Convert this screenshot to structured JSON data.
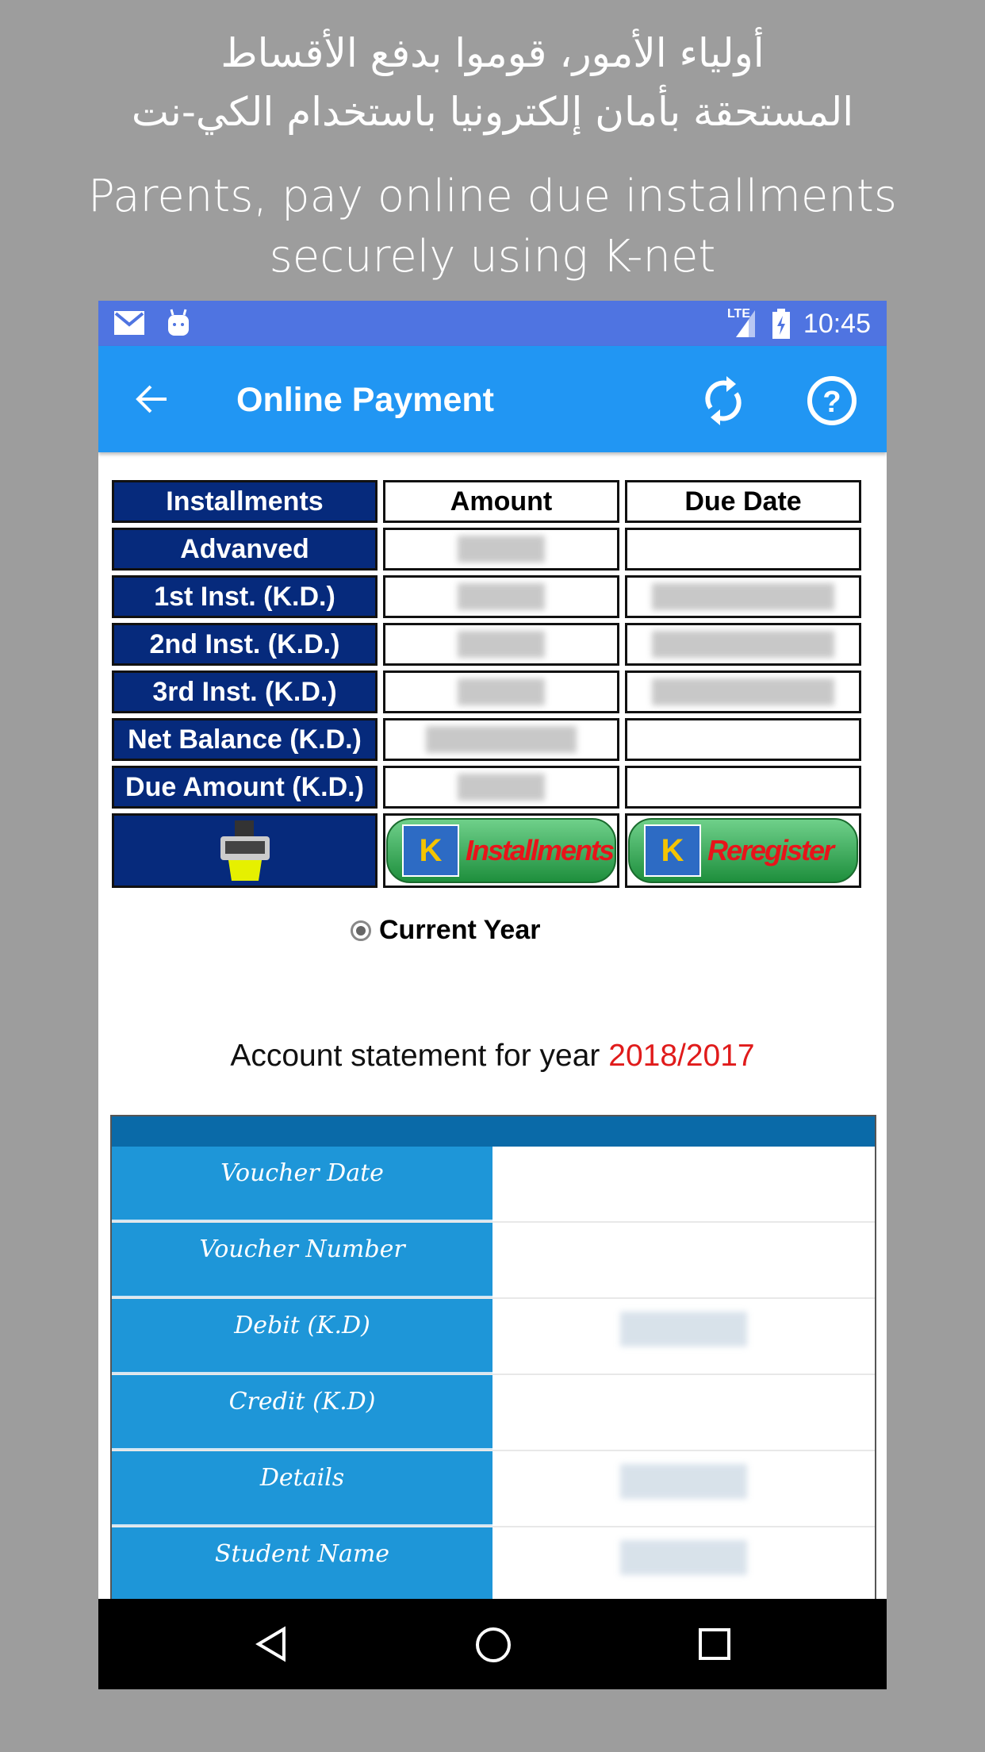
{
  "promo": {
    "arabic_line1": "أولياء الأمور، قوموا بدفع الأقساط",
    "arabic_line2": "المستحقة بأمان إلكترونيا باستخدام الكي-نت",
    "english_line1": "Parents, pay online due installments",
    "english_line2": "securely using K-net"
  },
  "status_bar": {
    "time": "10:45",
    "network": "LTE",
    "icons": [
      "mail-icon",
      "android-icon",
      "signal-icon",
      "battery-charging-icon"
    ]
  },
  "app_bar": {
    "title": "Online Payment",
    "icons": [
      "back-arrow-icon",
      "refresh-icon",
      "help-icon"
    ]
  },
  "installments_table": {
    "headers": [
      "Installments",
      "Amount",
      "Due Date"
    ],
    "rows": [
      {
        "label": "Advanved",
        "amount_blurred": true,
        "due_blurred": false
      },
      {
        "label": "1st Inst. (K.D.)",
        "amount_blurred": true,
        "due_blurred": true
      },
      {
        "label": "2nd Inst. (K.D.)",
        "amount_blurred": true,
        "due_blurred": true
      },
      {
        "label": "3rd Inst. (K.D.)",
        "amount_blurred": true,
        "due_blurred": true
      },
      {
        "label": "Net Balance (K.D.)",
        "amount_blurred": true,
        "due_blurred": false
      },
      {
        "label": "Due Amount (K.D.)",
        "amount_blurred": true,
        "due_blurred": false
      }
    ],
    "buttons": {
      "pay": "Installments",
      "reregister": "Reregister",
      "knet_logo": "K net"
    }
  },
  "year_option": {
    "label": "Current Year",
    "selected": true
  },
  "statement": {
    "prefix": "Account statement for year ",
    "year": "2018/2017",
    "year_color": "#e01b1b",
    "rows": [
      {
        "label": "Voucher Date",
        "blurred": false
      },
      {
        "label": "Voucher Number",
        "blurred": false
      },
      {
        "label": "Debit (K.D)",
        "blurred": true
      },
      {
        "label": "Credit (K.D)",
        "blurred": false
      },
      {
        "label": "Details",
        "blurred": true
      },
      {
        "label": "Student Name",
        "blurred": true
      }
    ]
  },
  "colors": {
    "status_bar": "#4f74e1",
    "app_bar": "#2196f3",
    "table_label": "#062a7c",
    "statement_label": "#1e96d8",
    "statement_band": "#0a6aa8"
  }
}
